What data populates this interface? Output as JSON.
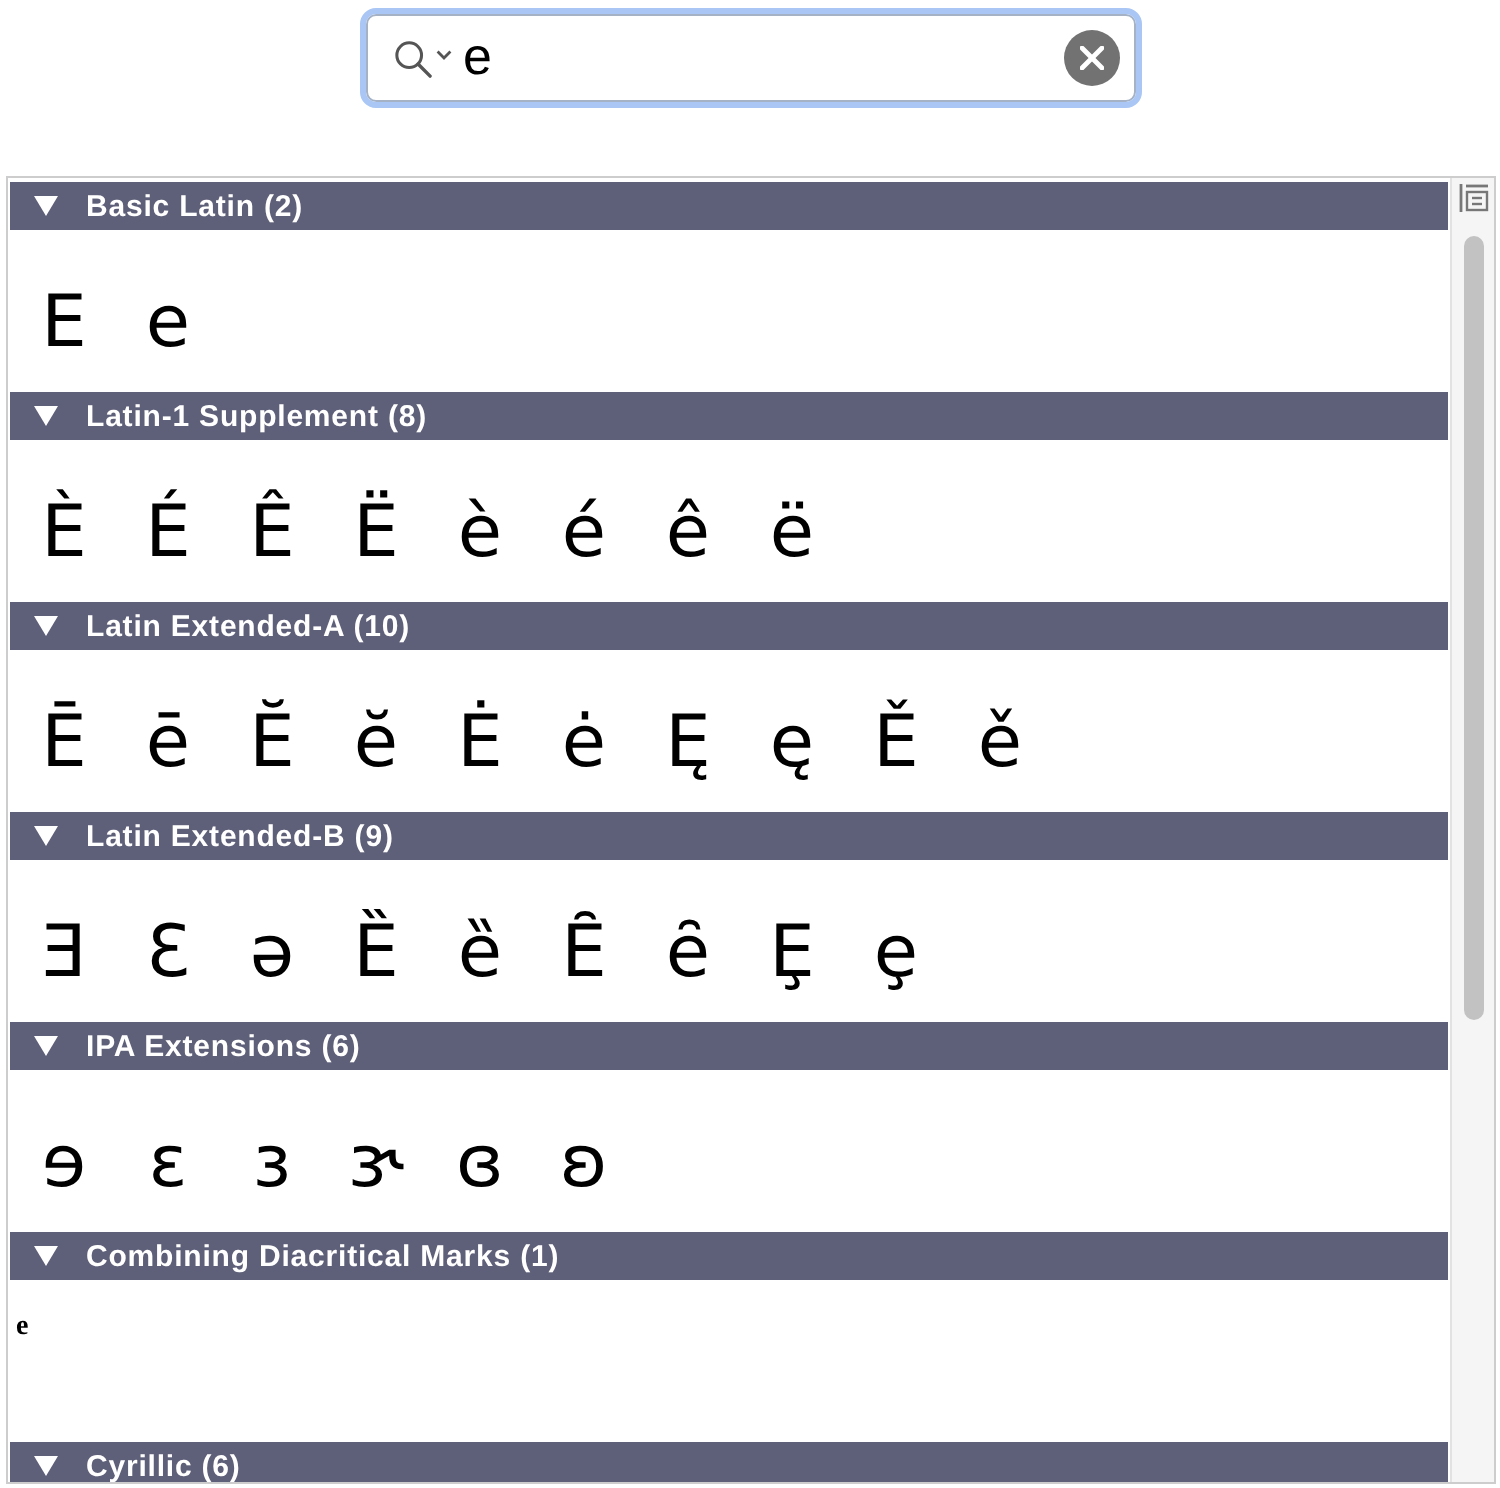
{
  "search": {
    "value": "e"
  },
  "sections": [
    {
      "title": "Basic Latin (2)",
      "expanded": true,
      "kind": "letters",
      "characters": [
        "E",
        "e"
      ]
    },
    {
      "title": "Latin-1 Supplement (8)",
      "expanded": true,
      "kind": "letters",
      "characters": [
        "È",
        "É",
        "Ê",
        "Ë",
        "è",
        "é",
        "ê",
        "ë"
      ]
    },
    {
      "title": "Latin Extended-A (10)",
      "expanded": true,
      "kind": "letters",
      "characters": [
        "Ē",
        "ē",
        "Ĕ",
        "ĕ",
        "Ė",
        "ė",
        "Ę",
        "ę",
        "Ě",
        "ě"
      ]
    },
    {
      "title": "Latin Extended-B (9)",
      "expanded": true,
      "kind": "letters",
      "characters": [
        "Ǝ",
        "Ɛ",
        "ǝ",
        "Ȅ",
        "ȅ",
        "Ȇ",
        "ȇ",
        "Ȩ",
        "ȩ"
      ]
    },
    {
      "title": "IPA Extensions (6)",
      "expanded": true,
      "kind": "letters",
      "characters": [
        "ɘ",
        "ɛ",
        "ɜ",
        "ɝ",
        "ɞ",
        "ʚ"
      ]
    },
    {
      "title": "Combining Diacritical Marks (1)",
      "expanded": true,
      "kind": "marks",
      "characters": [
        "e"
      ]
    },
    {
      "title": "Cyrillic (6)",
      "expanded": true
    }
  ]
}
